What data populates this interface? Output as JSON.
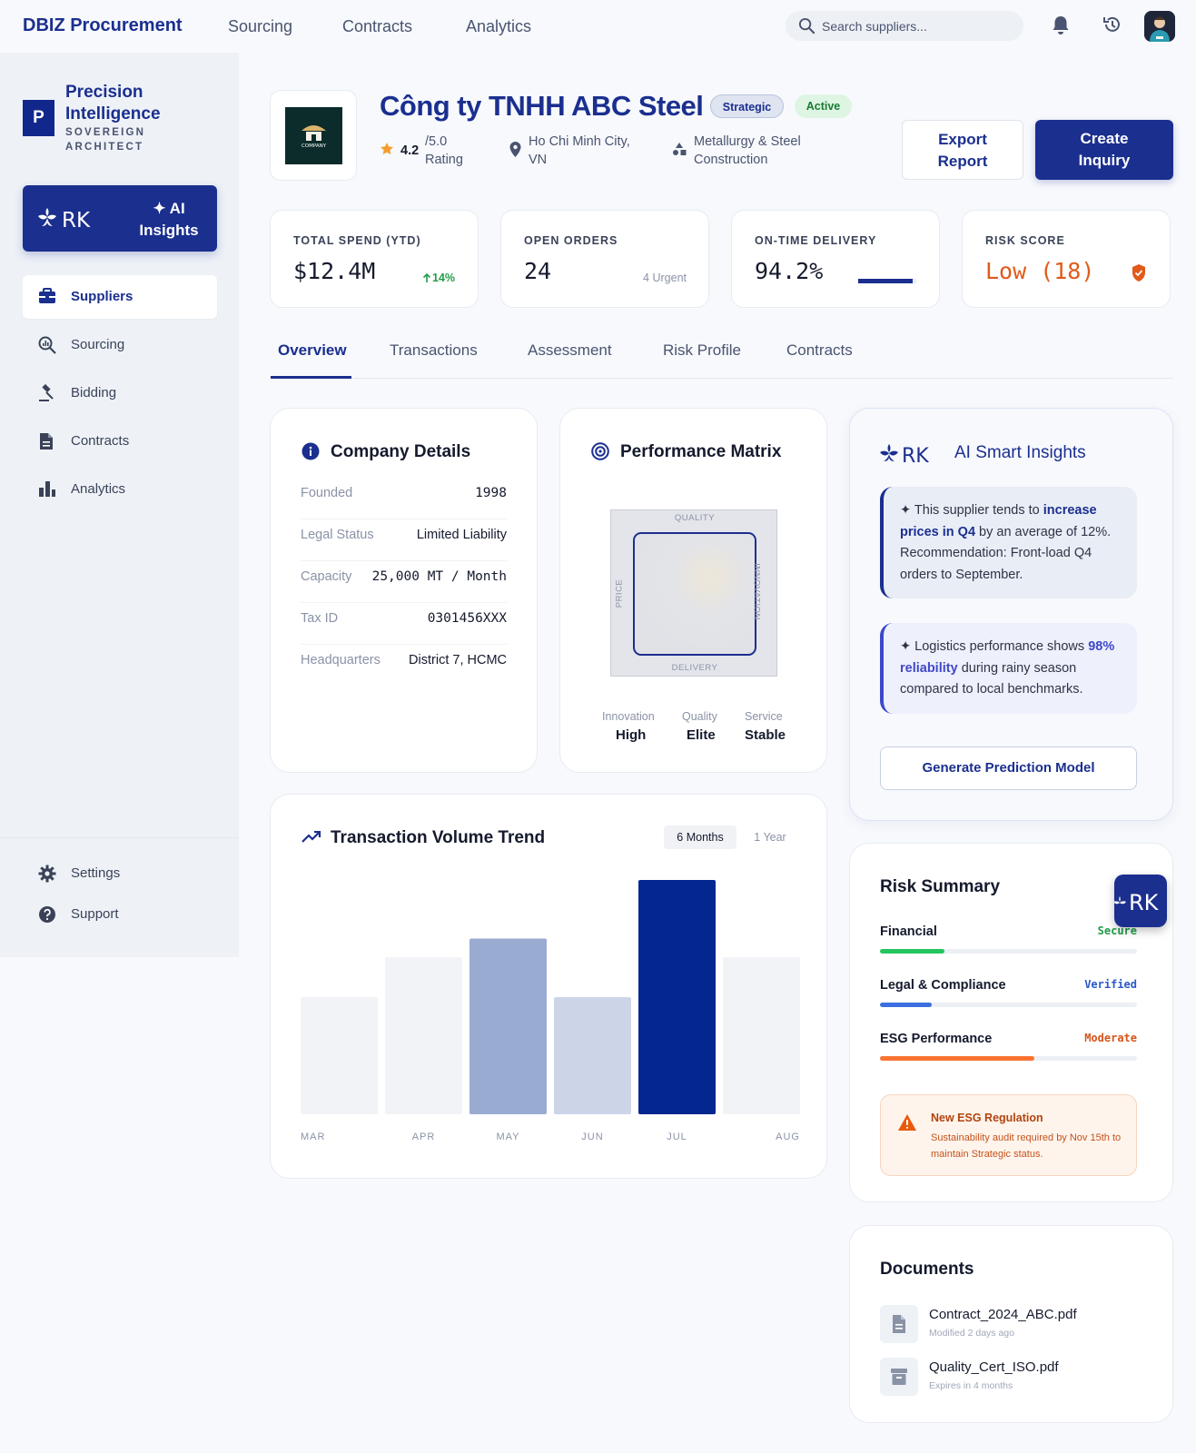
{
  "app": {
    "brand": "DBIZ Procurement",
    "top_nav": [
      "Sourcing",
      "Contracts",
      "Analytics"
    ],
    "search_placeholder": "Search suppliers..."
  },
  "sidebar": {
    "logo_letter": "P",
    "org_name": "Precision Intelligence",
    "org_sub": "SOVEREIGN ARCHITECT",
    "ai_button": "✦ AI Insights",
    "rk_logo_text": "RK",
    "items": [
      {
        "label": "Suppliers",
        "icon": "briefcase-icon",
        "active": true
      },
      {
        "label": "Sourcing",
        "icon": "search-analytics-icon",
        "active": false
      },
      {
        "label": "Bidding",
        "icon": "gavel-icon",
        "active": false
      },
      {
        "label": "Contracts",
        "icon": "document-icon",
        "active": false
      },
      {
        "label": "Analytics",
        "icon": "bar-chart-icon",
        "active": false
      }
    ],
    "bottom_items": [
      {
        "label": "Settings",
        "icon": "gear-icon"
      },
      {
        "label": "Support",
        "icon": "help-icon"
      }
    ]
  },
  "supplier": {
    "logo_text": "COMPANY",
    "name": "Công ty TNHH ABC Steel",
    "badges": [
      "Strategic",
      "Active"
    ],
    "rating": "4.2",
    "rating_scale": "/5.0",
    "rating_label": "Rating",
    "location_line1": "Ho Chi Minh City,",
    "location_line2": "VN",
    "industry_line1": "Metallurgy & Steel",
    "industry_line2": "Construction",
    "export_button": [
      "Export",
      "Report"
    ],
    "create_button": [
      "Create",
      "Inquiry"
    ]
  },
  "kpis": {
    "total_spend": {
      "label": "TOTAL SPEND (YTD)",
      "value": "$12.4M",
      "change": "14%"
    },
    "open_orders": {
      "label": "OPEN ORDERS",
      "value": "24",
      "sub": "4 Urgent"
    },
    "on_time": {
      "label": "ON-TIME DELIVERY",
      "value": "94.2%",
      "progress": 0.942
    },
    "risk": {
      "label": "RISK SCORE",
      "value": "Low (18)"
    }
  },
  "tabs": [
    "Overview",
    "Transactions",
    "Assessment",
    "Risk Profile",
    "Contracts"
  ],
  "company_details": {
    "title": "Company Details",
    "rows": [
      {
        "key": "Founded",
        "value": "1998"
      },
      {
        "key": "Legal Status",
        "value": "Limited Liability"
      },
      {
        "key": "Capacity",
        "value": "25,000 MT / Month"
      },
      {
        "key": "Tax ID",
        "value": "0301456XXX"
      },
      {
        "key": "Headquarters",
        "value": "District 7, HCMC"
      }
    ]
  },
  "performance_matrix": {
    "title": "Performance Matrix",
    "axes": {
      "top": "QUALITY",
      "bottom": "DELIVERY",
      "left": "PRICE",
      "right": "INNOVATION"
    },
    "stats": [
      {
        "key": "Innovation",
        "value": "High"
      },
      {
        "key": "Quality",
        "value": "Elite"
      },
      {
        "key": "Service",
        "value": "Stable"
      }
    ]
  },
  "ai_insights": {
    "title": "AI Smart Insights",
    "insight1": {
      "pre": "✦ This supplier tends to ",
      "highlight": "increase prices in Q4",
      "post": " by an average of 12%. Recommendation: Front-load Q4 orders to September."
    },
    "insight2": {
      "pre": "✦ Logistics performance shows ",
      "highlight": "98% reliability",
      "post": " during rainy season compared to local benchmarks."
    },
    "button": "Generate Prediction Model"
  },
  "risk_summary": {
    "title": "Risk Summary",
    "rows": [
      {
        "name": "Financial",
        "status": "Secure",
        "level": 0.25,
        "color": "#22c55e",
        "status_color": "#1f9d48"
      },
      {
        "name": "Legal & Compliance",
        "status": "Verified",
        "level": 0.2,
        "color": "#3b6fe0",
        "status_color": "#2a58c7"
      },
      {
        "name": "ESG Performance",
        "status": "Moderate",
        "level": 0.6,
        "color": "#f97330",
        "status_color": "#d6541a"
      }
    ],
    "alert_title": "New ESG Regulation",
    "alert_text": "Sustainability audit required by Nov 15th to maintain Strategic status."
  },
  "documents": {
    "title": "Documents",
    "items": [
      {
        "name": "Contract_2024_ABC.pdf",
        "meta": "Modified 2 days ago",
        "icon": "file-icon"
      },
      {
        "name": "Quality_Cert_ISO.pdf",
        "meta": "Expires in 4 months",
        "icon": "archive-icon"
      }
    ]
  },
  "transaction_trend": {
    "title": "Transaction Volume Trend",
    "range_options": [
      "6 Months",
      "1 Year"
    ],
    "selected_range": "6 Months"
  },
  "chart_data": {
    "type": "bar",
    "categories": [
      "MAR",
      "APR",
      "MAY",
      "JUN",
      "JUL",
      "AUG"
    ],
    "values": [
      50,
      67,
      75,
      50,
      100,
      67
    ],
    "colors": [
      "#f2f3f6",
      "#f2f3f6",
      "#9aabd2",
      "#ccd5e8",
      "#03268f",
      "#f2f3f6"
    ],
    "ylim": [
      0,
      100
    ]
  }
}
